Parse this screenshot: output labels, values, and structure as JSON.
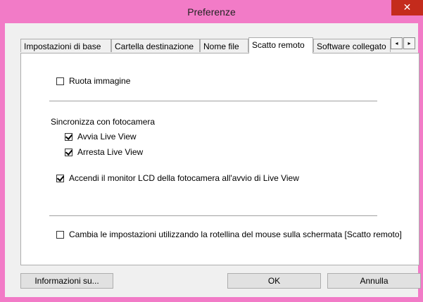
{
  "window": {
    "title": "Preferenze",
    "close_glyph": "✕"
  },
  "tabs": [
    {
      "label": "Impostazioni di base",
      "active": false
    },
    {
      "label": "Cartella destinazione",
      "active": false
    },
    {
      "label": "Nome file",
      "active": false
    },
    {
      "label": "Scatto remoto",
      "active": true
    },
    {
      "label": "Software collegato",
      "active": false
    }
  ],
  "tab_scroll": {
    "left_glyph": "◂",
    "right_glyph": "▸"
  },
  "options": {
    "rotate_image": {
      "label": "Ruota immagine",
      "checked": false
    },
    "sync_group_label": "Sincronizza con fotocamera",
    "start_live_view": {
      "label": "Avvia Live View",
      "checked": true
    },
    "stop_live_view": {
      "label": "Arresta Live View",
      "checked": true
    },
    "lcd_monitor": {
      "label": "Accendi il monitor LCD della fotocamera all'avvio di Live View",
      "checked": true
    },
    "mouse_wheel": {
      "label": "Cambia le impostazioni utilizzando la rotellina del mouse sulla schermata [Scatto remoto]",
      "checked": false
    }
  },
  "buttons": {
    "about": "Informazioni su...",
    "ok": "OK",
    "cancel": "Annulla"
  },
  "colors": {
    "accent_border": "#f27bc7",
    "close_button": "#c42b1c"
  }
}
